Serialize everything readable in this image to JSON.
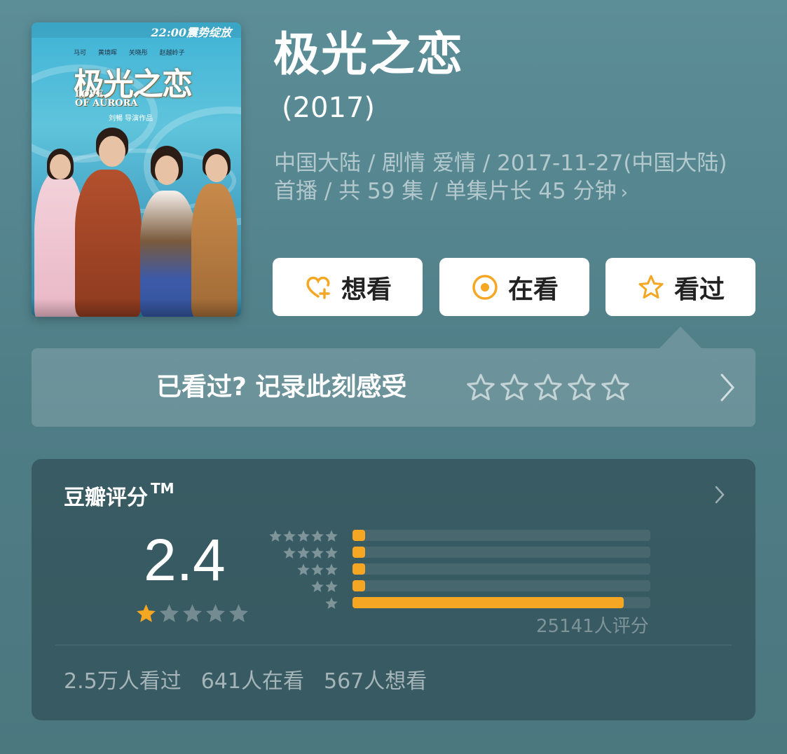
{
  "poster": {
    "title_cn": "极光之恋",
    "title_en_line1": "LOVE",
    "title_en_line2": "OF AURORA",
    "air_time": "22:00震势绽放",
    "director_credit": "刘暢 导演作品",
    "cast_names": "马可 黄境晖 关晓彤 赵越岭子"
  },
  "show": {
    "title": "极光之恋",
    "year": "(2017)",
    "meta_line1": "中国大陆 / 剧情 爱情 / 2017-11-27(中国大陆)",
    "meta_line2": "首播 / 共 59 集 / 单集片长 45 分钟",
    "meta_chevron": "›"
  },
  "buttons": {
    "want": "想看",
    "watching": "在看",
    "watched": "看过"
  },
  "record": {
    "prompt": "已看过? 记录此刻感受",
    "stars": 5
  },
  "rating": {
    "label": "豆瓣评分",
    "trademark": "TM",
    "score": "2.4",
    "score_stars_filled": 1,
    "score_stars_total": 5,
    "count_text": "25141人评分",
    "distribution": [
      {
        "stars": 5,
        "fraction": 0.04
      },
      {
        "stars": 4,
        "fraction": 0.04
      },
      {
        "stars": 3,
        "fraction": 0.04
      },
      {
        "stars": 2,
        "fraction": 0.04
      },
      {
        "stars": 1,
        "fraction": 0.91
      }
    ],
    "stats": {
      "watched": "2.5万人看过",
      "watching": "641人在看",
      "want": "567人想看"
    }
  },
  "colors": {
    "accent": "#f5a623",
    "background": "#5c8e98"
  }
}
